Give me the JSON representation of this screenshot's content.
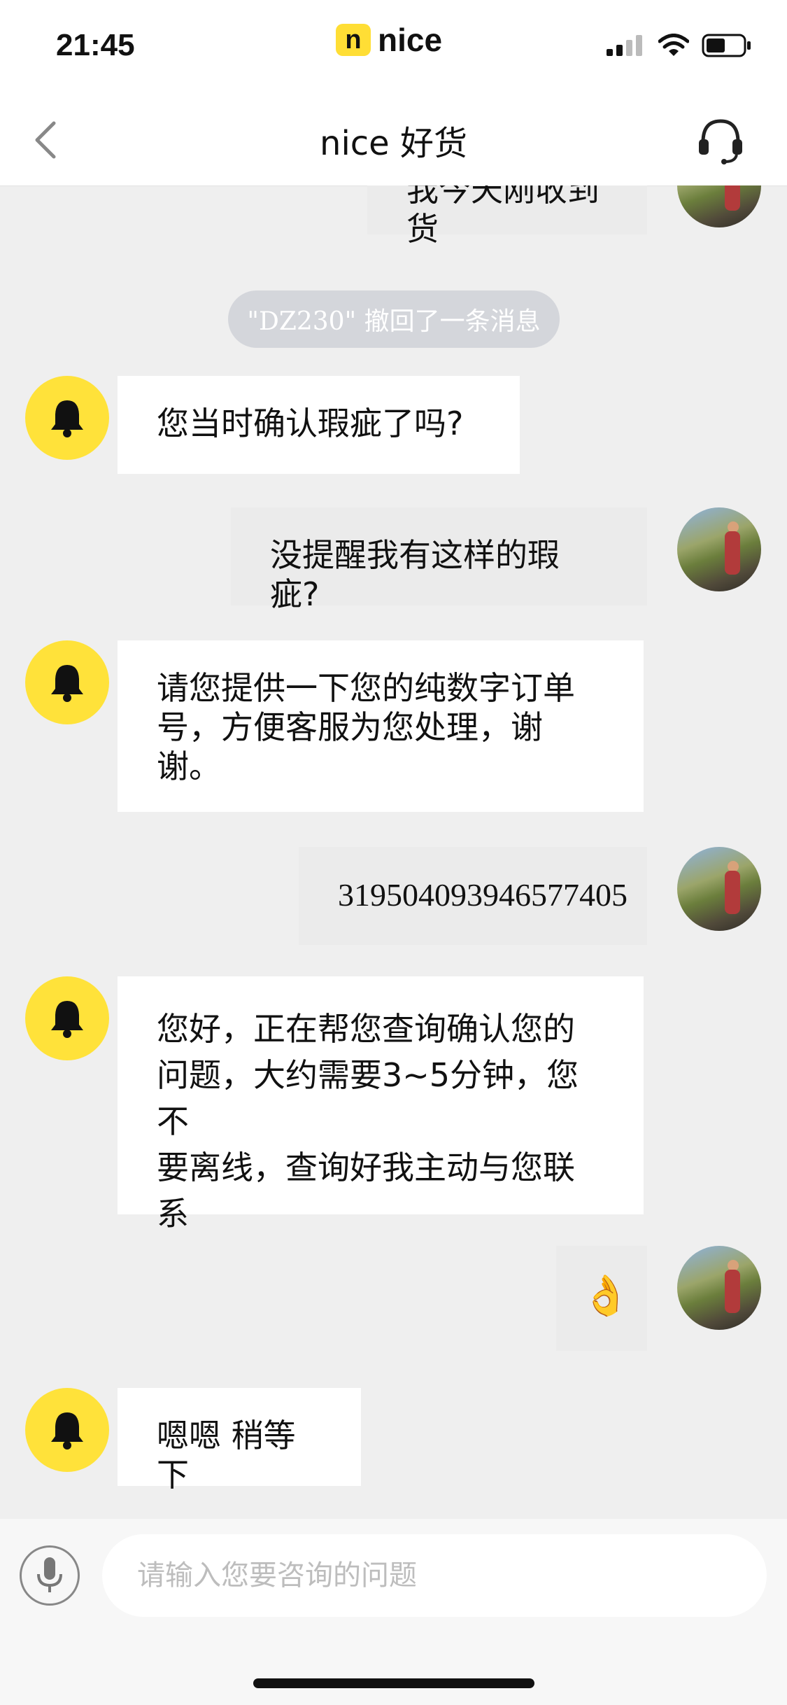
{
  "status_bar": {
    "time": "21:45",
    "brand_badge": "n",
    "brand_name": "nice"
  },
  "header": {
    "back_icon": "chevron-left-icon",
    "title": "nice 好货",
    "support_icon": "headset-icon"
  },
  "messages": [
    {
      "side": "right",
      "text": "我今天刚收到货"
    },
    {
      "type": "system",
      "text": "\"DZ230\" 撤回了一条消息"
    },
    {
      "side": "left",
      "text": "您当时确认瑕疵了吗?"
    },
    {
      "side": "right",
      "text": "没提醒我有这样的瑕疵?"
    },
    {
      "side": "left",
      "lines": [
        "请您提供一下您的纯数字订单",
        "号，方便客服为您处理，谢",
        "谢。"
      ]
    },
    {
      "side": "right",
      "text": "319504093946577405"
    },
    {
      "side": "left",
      "lines": [
        "您好，正在帮您查询确认您的",
        "问题，大约需要3~5分钟，您不",
        "要离线，查询好我主动与您联",
        "系"
      ]
    },
    {
      "side": "right",
      "text": "👌"
    },
    {
      "side": "left",
      "text": "嗯嗯 稍等下"
    }
  ],
  "input": {
    "placeholder": "请输入您要咨询的问题",
    "value": "",
    "mic_icon": "microphone-icon"
  },
  "colors": {
    "bell_avatar": "#ffe23a",
    "chat_bg": "#efefef",
    "brand_yellow": "#ffde35"
  }
}
